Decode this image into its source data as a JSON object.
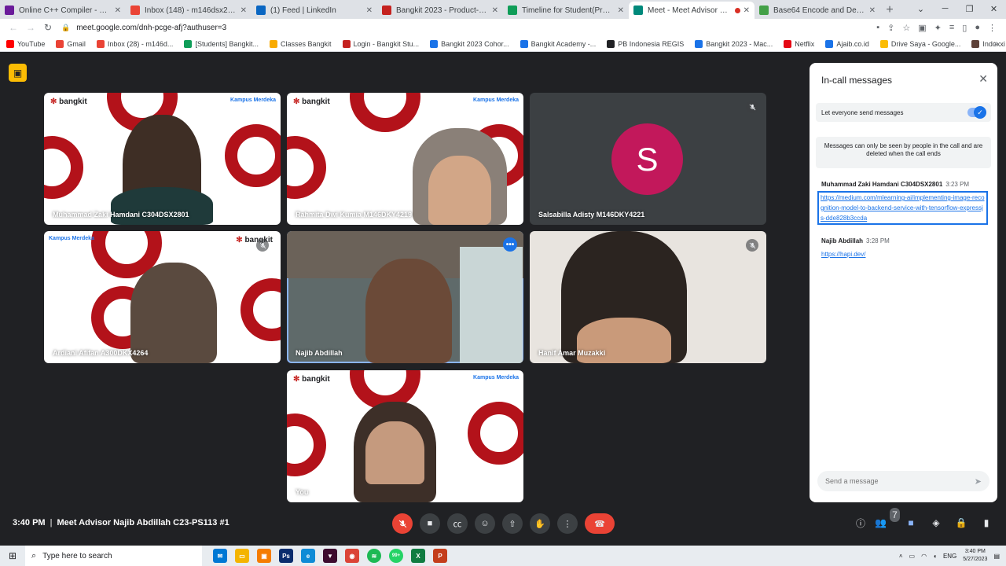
{
  "browser": {
    "tabs": [
      {
        "label": "Online C++ Compiler - online e",
        "color": "#6a1b9a"
      },
      {
        "label": "Inbox (148) - m146dsx2340@ba",
        "color": "#ea4335"
      },
      {
        "label": "(1) Feed | LinkedIn",
        "color": "#0a66c2"
      },
      {
        "label": "Bangkit 2023 - Product-Based",
        "color": "#c5221f"
      },
      {
        "label": "Timeline for Student(Product C",
        "color": "#0f9d58"
      },
      {
        "label": "Meet - Meet Advisor Najib",
        "color": "#00897b"
      },
      {
        "label": "Base64 Encode and Decode - O",
        "color": "#43a047"
      }
    ],
    "url": "meet.google.com/dnh-pcge-afj?authuser=3",
    "bookmarks": [
      {
        "label": "YouTube",
        "color": "#ff0000"
      },
      {
        "label": "Gmail",
        "color": "#ea4335"
      },
      {
        "label": "Inbox (28) - m146d...",
        "color": "#ea4335"
      },
      {
        "label": "[Students] Bangkit...",
        "color": "#0f9d58"
      },
      {
        "label": "Classes Bangkit",
        "color": "#f9ab00"
      },
      {
        "label": "Login - Bangkit Stu...",
        "color": "#c5221f"
      },
      {
        "label": "Bangkit 2023 Cohor...",
        "color": "#1a73e8"
      },
      {
        "label": "Bangkit Academy -...",
        "color": "#1a73e8"
      },
      {
        "label": "PB Indonesia REGIS",
        "color": "#202124"
      },
      {
        "label": "Bangkit 2023 - Mac...",
        "color": "#1a73e8"
      },
      {
        "label": "Netflix",
        "color": "#e50914"
      },
      {
        "label": "Ajaib.co.id",
        "color": "#1a73e8"
      },
      {
        "label": "Drive Saya - Google...",
        "color": "#fbbc04"
      },
      {
        "label": "Indoxxi - Situs Nont...",
        "color": "#5d4037"
      }
    ]
  },
  "tiles": [
    {
      "name": "Muhammad Zaki Hamdani C304DSX2801"
    },
    {
      "name": "Rahmita Dwi Kumia M146DKY4219"
    },
    {
      "name": "Salsabilla Adisty M146DKY4221",
      "initial": "S"
    },
    {
      "name": "Ardiani Afifan A300DKX4264"
    },
    {
      "name": "Najib Abdillah"
    },
    {
      "name": "Hanif Amar Muzakki"
    },
    {
      "name": "You"
    }
  ],
  "branding": {
    "logo": "bangkit",
    "km": "Kampus Merdeka"
  },
  "panel": {
    "title": "In-call messages",
    "toggle_label": "Let everyone send messages",
    "notice": "Messages can only be seen by people in the call and are deleted when the call ends",
    "messages": [
      {
        "sender": "Muhammad Zaki Hamdani C304DSX2801",
        "time": "3:23 PM",
        "text": "https://medium.com/mlearning-ai/implementing-image-recognition-model-to-backend-service-with-tensorflow-expressjs-dde828b3ccda"
      },
      {
        "sender": "Najib Abdillah",
        "time": "3:28 PM",
        "text": "https://hapi.dev/"
      }
    ],
    "composer_placeholder": "Send a message"
  },
  "meeting": {
    "time": "3:40 PM",
    "title": "Meet Advisor Najib Abdillah C23-PS113 #1",
    "participant_count": "7"
  },
  "taskbar": {
    "search_placeholder": "Type here to search",
    "lang": "ENG",
    "clock_time": "3:40 PM",
    "clock_date": "5/27/2023",
    "badge": "99+"
  }
}
